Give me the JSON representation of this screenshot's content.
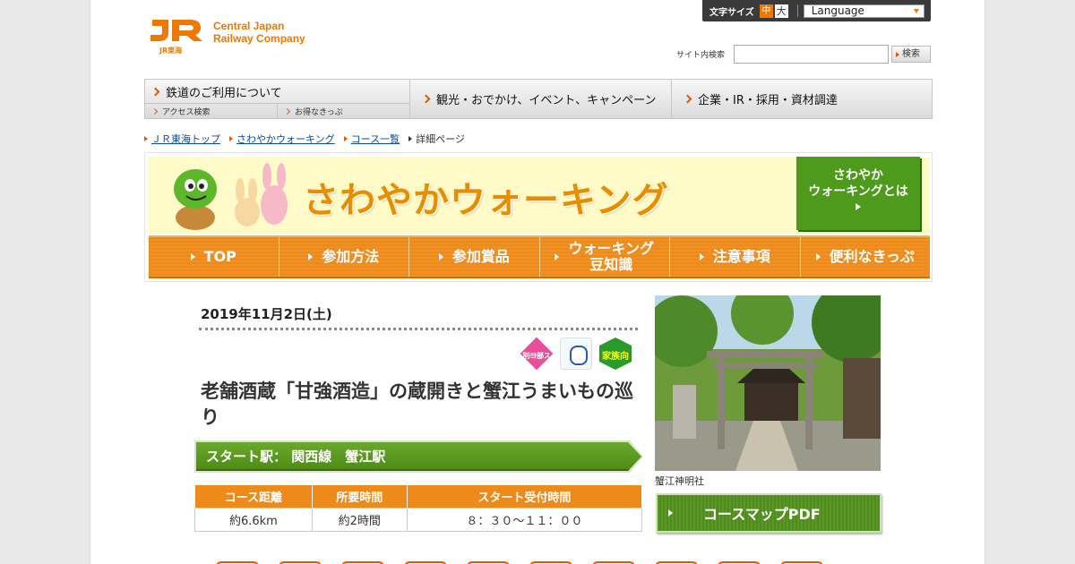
{
  "util": {
    "font_size_label": "文字サイズ",
    "font_mid": "中",
    "font_big": "大",
    "language_label": "Language"
  },
  "logo": {
    "mark": "JR",
    "company_line1": "Central Japan",
    "company_line2": "Railway Company",
    "sub": "JR東海"
  },
  "search": {
    "label": "サイト内検索",
    "value": "",
    "button": "検索"
  },
  "gnav": {
    "rail": "鉄道のご利用について",
    "access": "アクセス検索",
    "tickets": "お得なきっぷ",
    "tourism": "観光・おでかけ、イベント、キャンペーン",
    "corporate": "企業・IR・採用・資材調達"
  },
  "breadcrumb": {
    "top": "ＪＲ東海トップ",
    "walking": "さわやかウォーキング",
    "courses": "コース一覧",
    "current": "詳細ページ"
  },
  "banner": {
    "title": "さわやかウォーキング",
    "about_line1": "さわやか",
    "about_line2": "ウォーキングとは",
    "nav": [
      "TOP",
      "参加方法",
      "参加賞品",
      "ウォーキング",
      "豆知識",
      "注意事項",
      "便利なきっぷ"
    ]
  },
  "course": {
    "date": "2019年11月2日(土)",
    "icon_pink_line1": "一部",
    "icon_pink_line2": "別コース",
    "icon_family": "家族向",
    "title": "老舗酒蔵「甘強酒造」の蔵開きと蟹江うまいもの巡り",
    "start_station": "スタート駅：  関西線　蟹江駅",
    "table_headers": [
      "コース距離",
      "所要時間",
      "スタート受付時間"
    ],
    "table_values": [
      "約6.6km",
      "約2時間",
      "８：３０～１１：００"
    ],
    "photo_caption": "蟹江神明社",
    "pdf_button": "コースマップPDF"
  },
  "colors": {
    "orange": "#ee8a1a",
    "jr_orange": "#ee7800",
    "green": "#4d8a14"
  }
}
